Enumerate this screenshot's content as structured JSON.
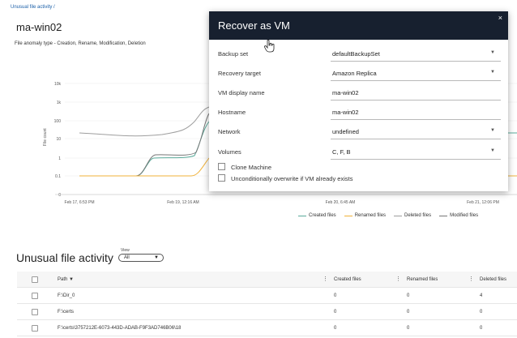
{
  "breadcrumb": "Unusual file activity /",
  "page_title": "ma-win02",
  "anomaly_type": "File anomaly type - Creation, Rename, Modification, Deletion",
  "chart": {
    "y_ticks": [
      "10k",
      "1k",
      "100",
      "10",
      "1",
      "0.1",
      "0"
    ],
    "y_label": "File count",
    "x_ticks": [
      "Feb 17, 6:53 PM",
      "Feb 19, 12:16 AM",
      "Feb 20, 6:45 AM",
      "Feb 21, 12:06 PM"
    ],
    "legend": [
      {
        "name": "Created files",
        "color": "#5aaa9a"
      },
      {
        "name": "Renamed files",
        "color": "#f0b23a"
      },
      {
        "name": "Deleted files",
        "color": "#9e9e9e"
      },
      {
        "name": "Modified files",
        "color": "#777777"
      }
    ]
  },
  "section_title": "Unusual file activity",
  "view": {
    "label": "View",
    "value": "All"
  },
  "table": {
    "headers": {
      "path": "Path ▼",
      "created": "Created files",
      "renamed": "Renamed files",
      "deleted": "Deleted files"
    },
    "rows": [
      {
        "path": "F:\\Dir_0",
        "created": "0",
        "renamed": "0",
        "deleted": "4"
      },
      {
        "path": "F:\\certs",
        "created": "0",
        "renamed": "0",
        "deleted": "0"
      },
      {
        "path": "F:\\certs\\3757212E-6073-443D-ADAB-F9F3AD746B06\\18",
        "created": "0",
        "renamed": "0",
        "deleted": "0"
      }
    ]
  },
  "modal": {
    "title": "Recover as VM",
    "close": "×",
    "fields": [
      {
        "label": "Backup set",
        "value": "defaultBackupSet",
        "dropdown": true
      },
      {
        "label": "Recovery target",
        "value": "Amazon Replica",
        "dropdown": true
      },
      {
        "label": "VM display name",
        "value": "ma-win02",
        "dropdown": false
      },
      {
        "label": "Hostname",
        "value": "ma-win02",
        "dropdown": false
      },
      {
        "label": "Network",
        "value": "undefined",
        "dropdown": true
      },
      {
        "label": "Volumes",
        "value": "C,  F,  B",
        "dropdown": true
      }
    ],
    "checkboxes": [
      {
        "label": "Clone Machine",
        "checked": false
      },
      {
        "label": "Unconditionally overwrite if VM already exists",
        "checked": false
      }
    ]
  }
}
